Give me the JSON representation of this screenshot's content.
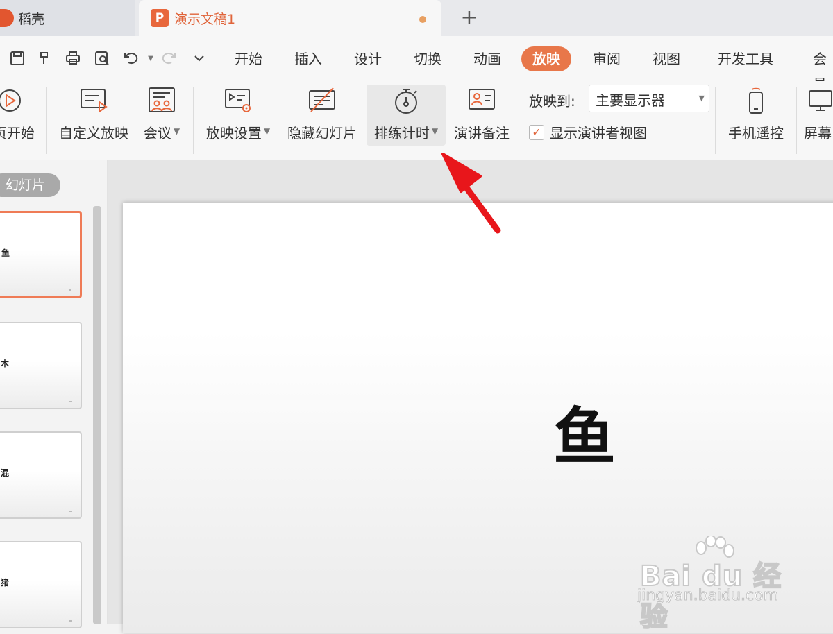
{
  "tabs": [
    {
      "label": "稻壳"
    },
    {
      "label": "演示文稿1",
      "logo_letter": "P"
    }
  ],
  "new_tab_symbol": "+",
  "menu": {
    "items": [
      "开始",
      "插入",
      "设计",
      "切换",
      "动画",
      "放映",
      "审阅",
      "视图",
      "开发工具",
      "会员"
    ],
    "active": "放映"
  },
  "ribbon": {
    "from_current": "页开始",
    "custom_show": "自定义放映",
    "meeting": "会议",
    "show_settings": "放映设置",
    "hide_slide": "隐藏幻灯片",
    "rehearse_timing": "排练计时",
    "speaker_notes": "演讲备注",
    "play_to_label": "放映到:",
    "display_value": "主要显示器",
    "presenter_view_label": "显示演讲者视图",
    "presenter_view_checked": true,
    "phone_remote": "手机遥控",
    "screen": "屏幕"
  },
  "left_panel": {
    "label": "幻灯片",
    "thumbnails": [
      "鱼",
      "木",
      "混",
      "猪"
    ]
  },
  "slide": {
    "text": "鱼"
  },
  "watermark": {
    "brand": "Bai du 经验",
    "url": "jingyan.baidu.com"
  },
  "colors": {
    "accent": "#e8774a",
    "arrow": "#e8161b"
  }
}
